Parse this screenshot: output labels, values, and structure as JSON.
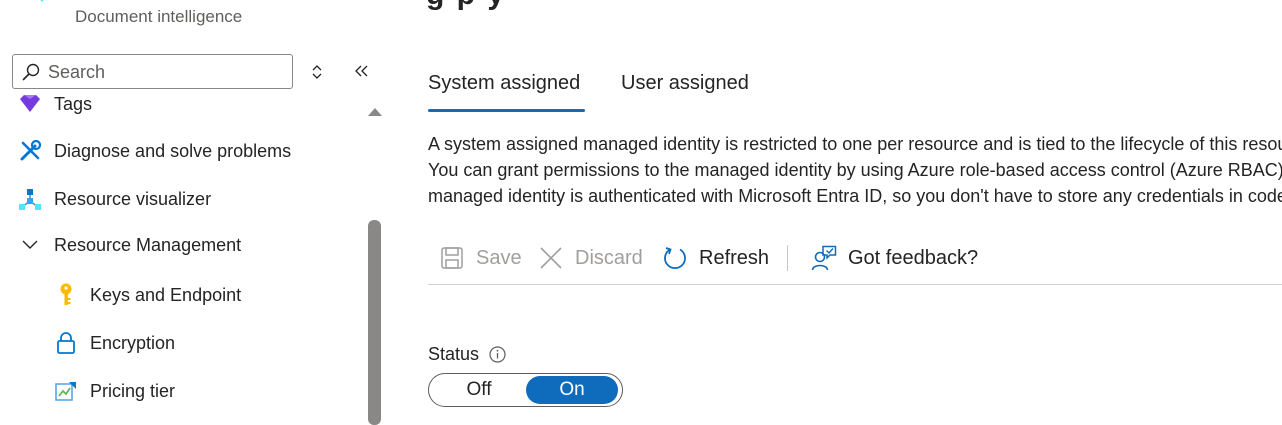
{
  "app": {
    "subtitle": "Document intelligence",
    "logo_icon": "document-intelligence-logo",
    "heading_fragment": "g     p      y"
  },
  "search": {
    "placeholder": "Search",
    "value": ""
  },
  "sidebar": {
    "items": [
      {
        "label": "Tags",
        "icon": "tag-icon",
        "level": 0
      },
      {
        "label": "Diagnose and solve problems",
        "icon": "wrench-screwdriver-icon",
        "level": 0
      },
      {
        "label": "Resource visualizer",
        "icon": "resource-graph-icon",
        "level": 0
      },
      {
        "label": "Resource Management",
        "icon": "chevron-down-icon",
        "level": 0,
        "expanded": true
      },
      {
        "label": "Keys and Endpoint",
        "icon": "key-icon",
        "level": 1
      },
      {
        "label": "Encryption",
        "icon": "lock-icon",
        "level": 1
      },
      {
        "label": "Pricing tier",
        "icon": "pricing-tier-icon",
        "level": 1
      }
    ]
  },
  "tabs": [
    {
      "label": "System assigned",
      "active": true
    },
    {
      "label": "User assigned",
      "active": false
    }
  ],
  "description": "A system assigned managed identity is restricted to one per resource and is tied to the lifecycle of this resource. You can grant permissions to the managed identity by using Azure role-based access control (Azure RBAC). The managed identity is authenticated with Microsoft Entra ID, so you don't have to store any credentials in code.",
  "toolbar": {
    "save_label": "Save",
    "discard_label": "Discard",
    "refresh_label": "Refresh",
    "feedback_label": "Got feedback?"
  },
  "status": {
    "label": "Status",
    "off_label": "Off",
    "on_label": "On",
    "selected": "On"
  },
  "colors": {
    "accent": "#0f6cbd",
    "disabled_text": "#a19f9d",
    "key_gold": "#ffb900"
  }
}
